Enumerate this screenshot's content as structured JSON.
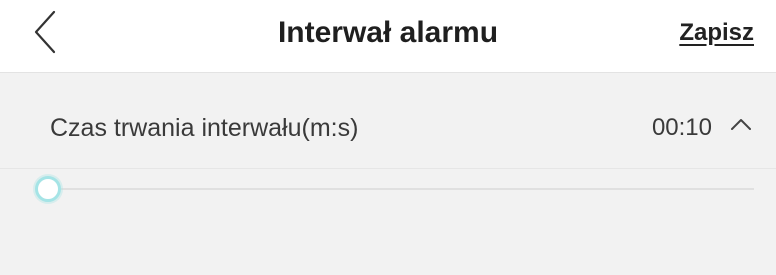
{
  "header": {
    "title": "Interwał alarmu",
    "save_label": "Zapisz",
    "back_icon": "chevron-left-icon"
  },
  "interval_row": {
    "label": "Czas trwania interwału(m:s)",
    "value": "00:10",
    "expand_icon": "chevron-up-icon"
  },
  "slider": {
    "position": 0,
    "thumb_color": "#a5e4e6",
    "track_color": "#e0e0e0"
  }
}
